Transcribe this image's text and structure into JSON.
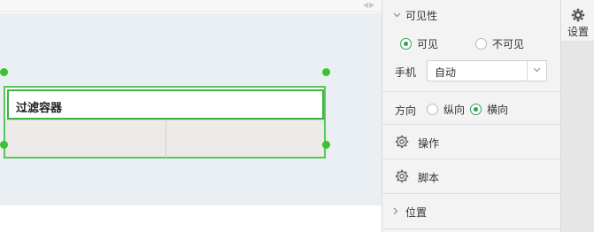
{
  "canvas": {
    "collapse_icon": "double-chevron-icon",
    "widget_title": "过滤容器"
  },
  "panel": {
    "visibility": {
      "title": "可见性",
      "visible_label": "可见",
      "invisible_label": "不可见",
      "selected": "可见",
      "mobile_label": "手机",
      "mobile_value": "自动"
    },
    "direction": {
      "label": "方向",
      "vertical_label": "纵向",
      "horizontal_label": "横向",
      "selected": "横向"
    },
    "operation_label": "操作",
    "script_label": "脚本",
    "position_label": "位置"
  },
  "tabs": {
    "settings_label": "设置"
  },
  "colors": {
    "accent_green": "#39c42d",
    "radio_green": "#2ea44f",
    "canvas_bg": "#e9eff2"
  }
}
